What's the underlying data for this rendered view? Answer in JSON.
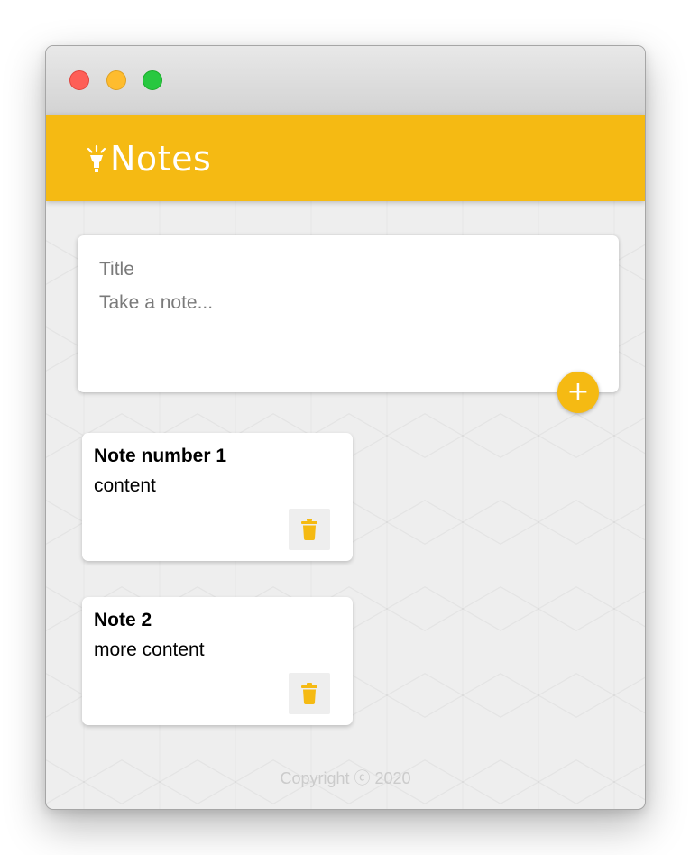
{
  "window": {
    "controls": [
      "close",
      "minimize",
      "maximize"
    ]
  },
  "header": {
    "logo_icon": "highlight-lamp-icon",
    "title": "Notes"
  },
  "create_area": {
    "title_placeholder": "Title",
    "content_placeholder": "Take a note...",
    "add_button_label": "+",
    "add_icon": "plus-icon"
  },
  "notes": [
    {
      "title": "Note number 1",
      "content": "content",
      "delete_icon": "trash-icon"
    },
    {
      "title": "Note 2",
      "content": "more content",
      "delete_icon": "trash-icon"
    }
  ],
  "footer": {
    "text": "Copyright ⓒ 2020"
  },
  "colors": {
    "accent": "#f5ba13",
    "background": "#eeeeee",
    "card": "#ffffff",
    "footer_text": "#cbcbcb"
  }
}
